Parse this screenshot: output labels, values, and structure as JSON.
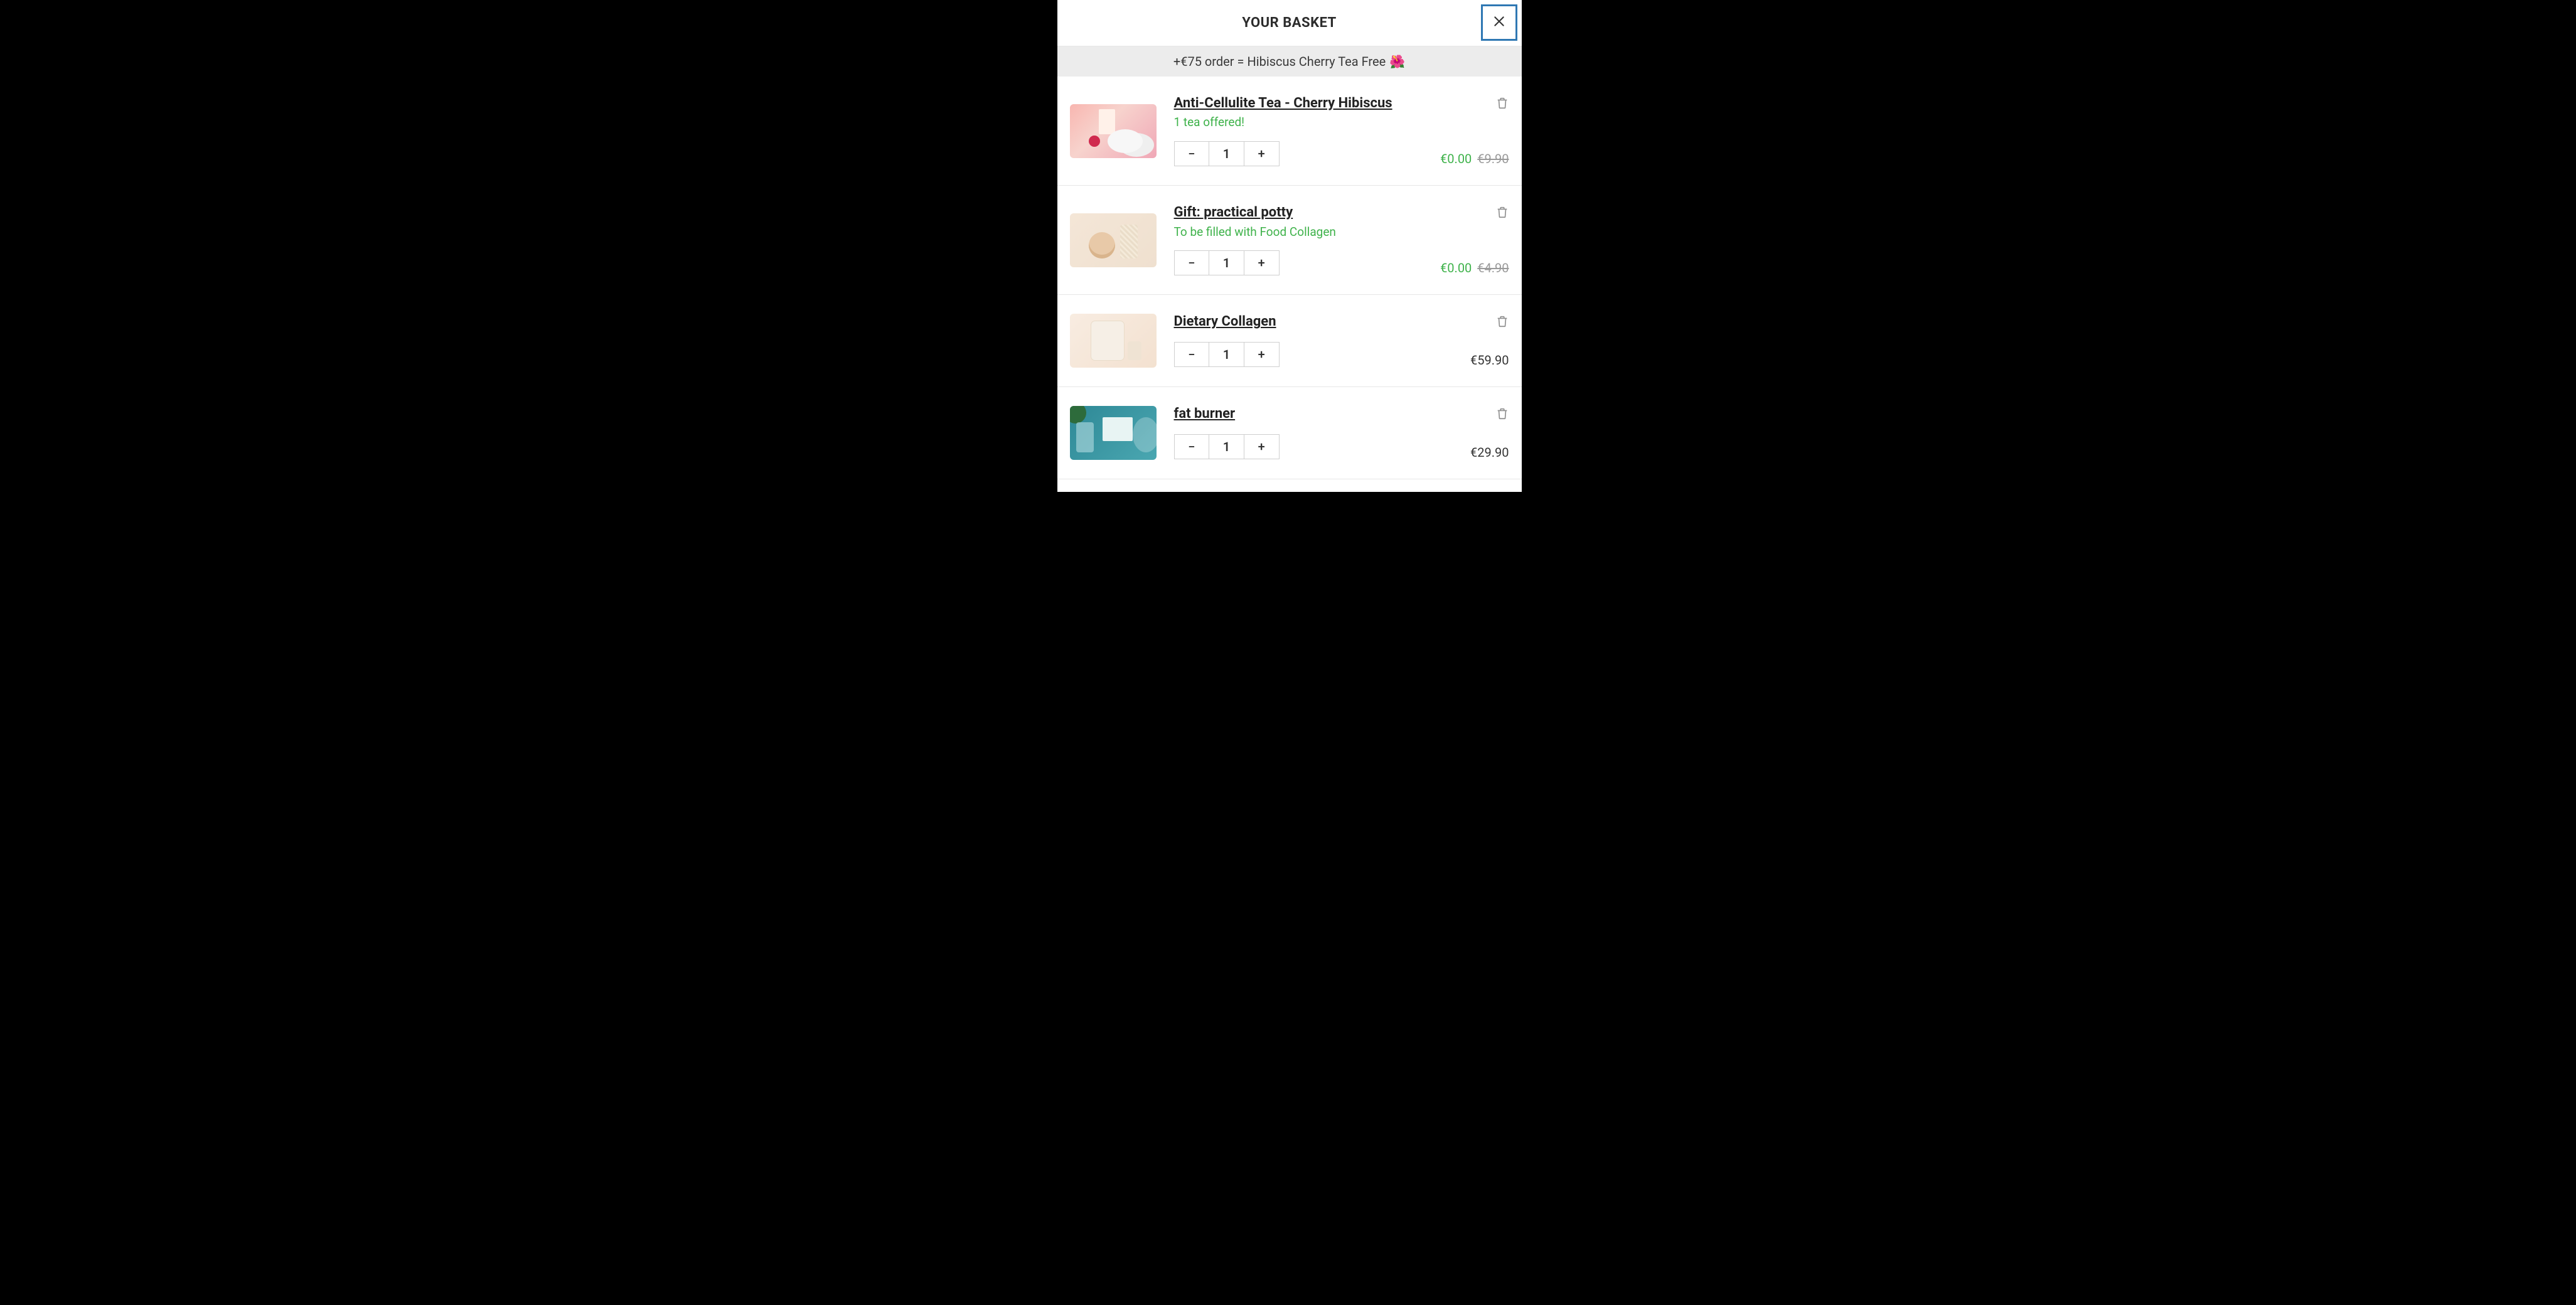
{
  "header": {
    "title": "YOUR BASKET"
  },
  "promo": {
    "text": "+€75 order = Hibiscus Cherry Tea Free",
    "emoji": "🌺"
  },
  "items": [
    {
      "title": "Anti-Cellulite Tea - Cherry Hibiscus",
      "subtitle": "1 tea offered!",
      "qty": "1",
      "price_free": "€0.00",
      "price_old": "€9.90",
      "thumb_class": "t1"
    },
    {
      "title": "Gift: practical potty",
      "subtitle": "To be filled with Food Collagen",
      "qty": "1",
      "price_free": "€0.00",
      "price_old": "€4.90",
      "thumb_class": "t2"
    },
    {
      "title": "Dietary Collagen",
      "qty": "1",
      "price": "€59.90",
      "thumb_class": "t3"
    },
    {
      "title": "fat burner",
      "qty": "1",
      "price": "€29.90",
      "thumb_class": "t4"
    }
  ]
}
